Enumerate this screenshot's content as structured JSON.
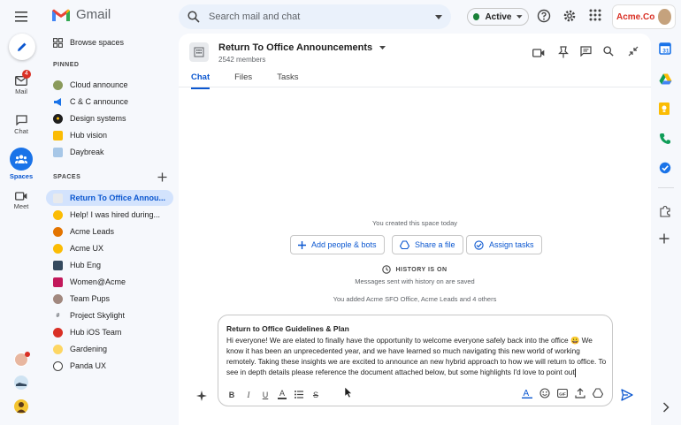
{
  "app": {
    "name": "Gmail"
  },
  "search": {
    "placeholder": "Search mail and chat"
  },
  "status": {
    "label": "Active",
    "color": "#188038"
  },
  "org": {
    "name": "Acme.Co"
  },
  "rail": {
    "mail": {
      "label": "Mail",
      "badge": "4"
    },
    "chat": {
      "label": "Chat"
    },
    "spaces": {
      "label": "Spaces"
    },
    "meet": {
      "label": "Meet"
    }
  },
  "sidebar": {
    "browse": "Browse spaces",
    "pinned_heading": "PINNED",
    "pinned": [
      {
        "label": "Cloud announce"
      },
      {
        "label": "C & C announce"
      },
      {
        "label": "Design systems"
      },
      {
        "label": "Hub vision"
      },
      {
        "label": "Daybreak"
      }
    ],
    "spaces_heading": "SPACES",
    "spaces": [
      {
        "label": "Return To Office Annou..."
      },
      {
        "label": "Help! I was hired during..."
      },
      {
        "label": "Acme Leads"
      },
      {
        "label": "Acme UX"
      },
      {
        "label": "Hub Eng"
      },
      {
        "label": "Women@Acme"
      },
      {
        "label": "Team Pups"
      },
      {
        "label": "Project Skylight"
      },
      {
        "label": "Hub iOS Team"
      },
      {
        "label": "Gardening"
      },
      {
        "label": "Panda UX"
      }
    ]
  },
  "room": {
    "title": "Return To Office Announcements",
    "members": "2542 members",
    "tabs": [
      "Chat",
      "Files",
      "Tasks"
    ]
  },
  "feed": {
    "created": "You created this space today",
    "add_people": "Add people & bots",
    "share_file": "Share a file",
    "assign_tasks": "Assign tasks",
    "history_title": "HISTORY IS ON",
    "history_sub": "Messages sent with history on are saved",
    "added_note": "You added Acme SFO Office, Acme Leads and 4 others"
  },
  "composer": {
    "title": "Return to Office Guidelines & Plan",
    "body": "Hi everyone! We are elated to finally have the opportunity to welcome everyone safely back into the office 😀 We know it has been an unprecedented year, and we have learned so much navigating this new world of working remotely. Taking these insights we are excited to announce an new hybrid approach to how we will return to office. To see in depth details please reference the document attached below, but some highlights I'd love to point out"
  },
  "colors": {
    "accent": "#0b57d0",
    "active_bg": "#d3e3fd",
    "alert": "#d93025"
  }
}
